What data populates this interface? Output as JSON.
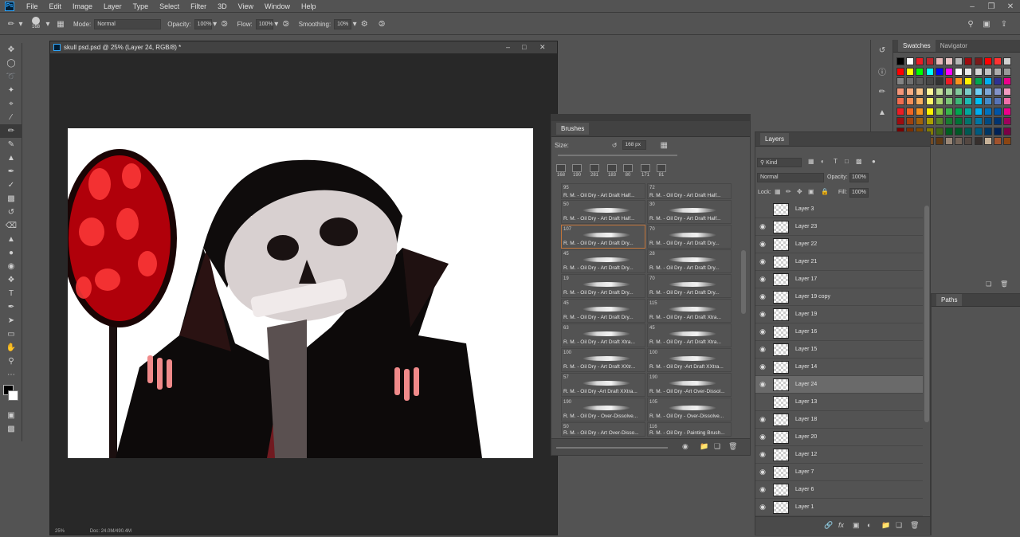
{
  "menubar": {
    "items": [
      "File",
      "Edit",
      "Image",
      "Layer",
      "Type",
      "Select",
      "Filter",
      "3D",
      "View",
      "Window",
      "Help"
    ]
  },
  "options": {
    "brush_size": "168",
    "mode_label": "Mode:",
    "mode_value": "Normal",
    "opacity_label": "Opacity:",
    "opacity_value": "100%",
    "flow_label": "Flow:",
    "flow_value": "100%",
    "smoothing_label": "Smoothing:",
    "smoothing_value": "10%"
  },
  "document": {
    "title": "skull psd.psd @ 25% (Layer 24, RGB/8) *",
    "zoom": "25%",
    "doc_size": "Doc: 24.0M/490.4M"
  },
  "brushes": {
    "title": "Brushes",
    "size_label": "Size:",
    "size_value": "168 px",
    "thumbs": [
      "168",
      "190",
      "281",
      "183",
      "80",
      "171",
      "81"
    ],
    "items": [
      {
        "num": "95",
        "name": "R. M. - Oil Dry - Art Draft Half..."
      },
      {
        "num": "72",
        "name": "R. M. - Oil Dry - Art Draft Half..."
      },
      {
        "num": "50",
        "name": "R. M. - Oil Dry - Art Draft Half..."
      },
      {
        "num": "30",
        "name": "R. M. - Oil Dry - Art Draft Half..."
      },
      {
        "num": "107",
        "name": "R. M. - Oil Dry - Art Draft Dry..."
      },
      {
        "num": "70",
        "name": "R. M. - Oil Dry - Art Draft Dry..."
      },
      {
        "num": "45",
        "name": "R. M. - Oil Dry - Art Draft Dry..."
      },
      {
        "num": "28",
        "name": "R. M. - Oil Dry - Art Draft Dry..."
      },
      {
        "num": "19",
        "name": "R. M. - Oil Dry - Art Draft Dry..."
      },
      {
        "num": "70",
        "name": "R. M. - Oil Dry - Art Draft Dry..."
      },
      {
        "num": "45",
        "name": "R. M. - Oil Dry - Art Draft Dry..."
      },
      {
        "num": "115",
        "name": "R. M. - Oil Dry - Art Draft Xtra..."
      },
      {
        "num": "63",
        "name": "R. M. - Oil Dry - Art Draft Xtra..."
      },
      {
        "num": "45",
        "name": "R. M. - Oil Dry - Art Draft Xtra..."
      },
      {
        "num": "100",
        "name": "R. M. - Oil Dry - Art Draft XXtr..."
      },
      {
        "num": "100",
        "name": "R. M. - Oil Dry -Art Draft XXtra..."
      },
      {
        "num": "57",
        "name": "R. M. - Oil Dry -Art Draft XXtra..."
      },
      {
        "num": "190",
        "name": "R. M. - Oil Dry -Art Over-Dissol..."
      },
      {
        "num": "190",
        "name": "R. M. - Oil Dry - Over-Dissolve..."
      },
      {
        "num": "105",
        "name": "R. M. - Oil Dry - Over-Dissolve..."
      },
      {
        "num": "50",
        "name": "R. M. - Oil Dry - Art Over-Disso..."
      },
      {
        "num": "116",
        "name": "R. M. - Oil Dry - Painting Brush..."
      }
    ]
  },
  "layers": {
    "title": "Layers",
    "kind_label": "Kind",
    "blend_mode": "Normal",
    "opacity_label": "Opacity:",
    "opacity_value": "100%",
    "lock_label": "Lock:",
    "fill_label": "Fill:",
    "fill_value": "100%",
    "rows": [
      {
        "name": "Layer 3",
        "visible": false
      },
      {
        "name": "Layer 23",
        "visible": true
      },
      {
        "name": "Layer 22",
        "visible": true
      },
      {
        "name": "Layer 21",
        "visible": true
      },
      {
        "name": "Layer 17",
        "visible": true
      },
      {
        "name": "Layer 19 copy",
        "visible": true
      },
      {
        "name": "Layer 19",
        "visible": true
      },
      {
        "name": "Layer 16",
        "visible": true
      },
      {
        "name": "Layer 15",
        "visible": true
      },
      {
        "name": "Layer 14",
        "visible": true
      },
      {
        "name": "Layer 24",
        "visible": true,
        "selected": true
      },
      {
        "name": "Layer 13",
        "visible": false
      },
      {
        "name": "Layer 18",
        "visible": true
      },
      {
        "name": "Layer 20",
        "visible": true
      },
      {
        "name": "Layer 12",
        "visible": true
      },
      {
        "name": "Layer 7",
        "visible": true
      },
      {
        "name": "Layer 6",
        "visible": true
      },
      {
        "name": "Layer 1",
        "visible": true
      }
    ]
  },
  "swatches": {
    "tab_swatches": "Swatches",
    "tab_navigator": "Navigator",
    "colors": [
      "#000000",
      "#ffffff",
      "#ed1c24",
      "#c1272d",
      "#e6b8b8",
      "#e8c4c4",
      "#b5b5b5",
      "#9e0b0f",
      "#7a1a1a",
      "#ff0000",
      "#ff3333",
      "#d0d0d0",
      "#ff0000",
      "#ffff00",
      "#00ff00",
      "#00ffff",
      "#0000ff",
      "#ff00ff",
      "#ffffff",
      "#ebebeb",
      "#d6d6d6",
      "#c2c2c2",
      "#adadad",
      "#999999",
      "#858585",
      "#707070",
      "#5c5c5c",
      "#474747",
      "#333333",
      "#ed1c24",
      "#f7941d",
      "#fff200",
      "#00a651",
      "#00aeef",
      "#2e3192",
      "#ec008c",
      "#f69679",
      "#f9ad81",
      "#fdc689",
      "#fff799",
      "#c4df9b",
      "#a3d39c",
      "#82ca9c",
      "#7accc8",
      "#6dcff6",
      "#7da7d9",
      "#8393ca",
      "#f49ac1",
      "#f26c4f",
      "#f68e56",
      "#fbaf5d",
      "#fff568",
      "#acd373",
      "#7cc576",
      "#3cb878",
      "#1cbbb4",
      "#00bff3",
      "#448ccb",
      "#5674b9",
      "#f06eaa",
      "#ed1c24",
      "#f26522",
      "#f7941d",
      "#fff200",
      "#8dc63f",
      "#39b54a",
      "#00a651",
      "#00a99d",
      "#00aeef",
      "#0072bc",
      "#0054a6",
      "#ec008c",
      "#9e0b0f",
      "#a0410d",
      "#a36209",
      "#aba000",
      "#598527",
      "#197b30",
      "#007236",
      "#00746b",
      "#0076a3",
      "#004a80",
      "#003471",
      "#9e005d",
      "#790000",
      "#7b2e00",
      "#7d4900",
      "#827b00",
      "#406618",
      "#005e20",
      "#005826",
      "#005952",
      "#005b7f",
      "#003663",
      "#002157",
      "#7b0046",
      "#c69c6d",
      "#a67c52",
      "#8c6239",
      "#754c24",
      "#603913",
      "#998675",
      "#736357",
      "#534741",
      "#362f2d",
      "#c7b299",
      "#a0522d",
      "#8b4513"
    ]
  },
  "paths": {
    "title": "Paths"
  }
}
